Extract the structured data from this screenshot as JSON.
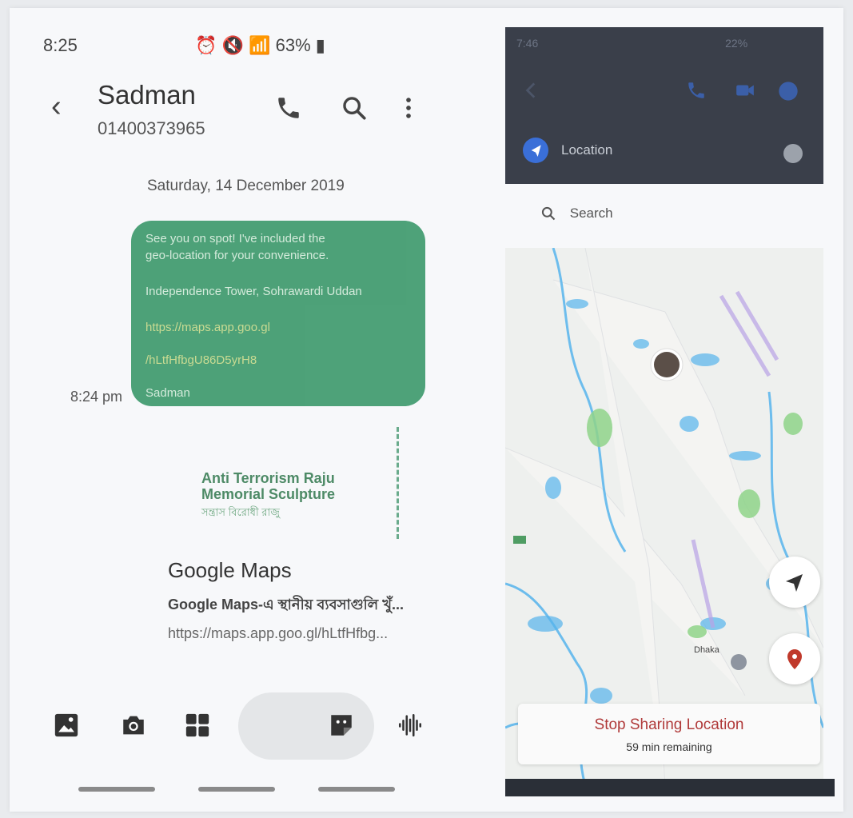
{
  "left_phone": {
    "status": {
      "time": "8:25",
      "battery": "63%"
    },
    "header": {
      "contact_name": "Sadman",
      "contact_number": "01400373965"
    },
    "conversation": {
      "date_separator": "Saturday, 14 December 2019",
      "message": {
        "line1": "See you on spot! I've included the",
        "line2": "geo-location for your convenience.",
        "place": "Independence Tower, Sohrawardi Uddan",
        "link1": "https://maps.app.goo.gl",
        "link2": "/hLtfHfbgU86D5yrH8",
        "signature": "Sadman",
        "time": "8:24 pm"
      },
      "link_preview": {
        "map_label": "Anti Terrorism Raju Memorial Sculpture",
        "map_sub": "সন্ত্রাস বিরোধী রাজু",
        "title": "Google Maps",
        "description": "Google Maps-এ স্থানীয় ব্যবসাগুলি খুঁ...",
        "url": "https://maps.app.goo.gl/hLtfHfbg..."
      }
    },
    "bottom_bar": {
      "icons": [
        "gallery-icon",
        "camera-icon",
        "apps-grid-icon",
        "sticker-icon",
        "voice-icon"
      ]
    }
  },
  "right_phone": {
    "status": {
      "time": "7:46",
      "battery": "22%"
    },
    "location_panel": {
      "label": "Location"
    },
    "search": {
      "placeholder": "Search"
    },
    "map": {
      "city_label": "Dhaka"
    },
    "sharing": {
      "title": "Stop Sharing Location",
      "remaining": "59 min remaining"
    }
  },
  "colors": {
    "bubble": "#3f9a6e",
    "stop_text": "#b03a3a",
    "location_blue": "#3a6fd8",
    "map_water": "#56b4ec",
    "map_park": "#8fd48a"
  }
}
